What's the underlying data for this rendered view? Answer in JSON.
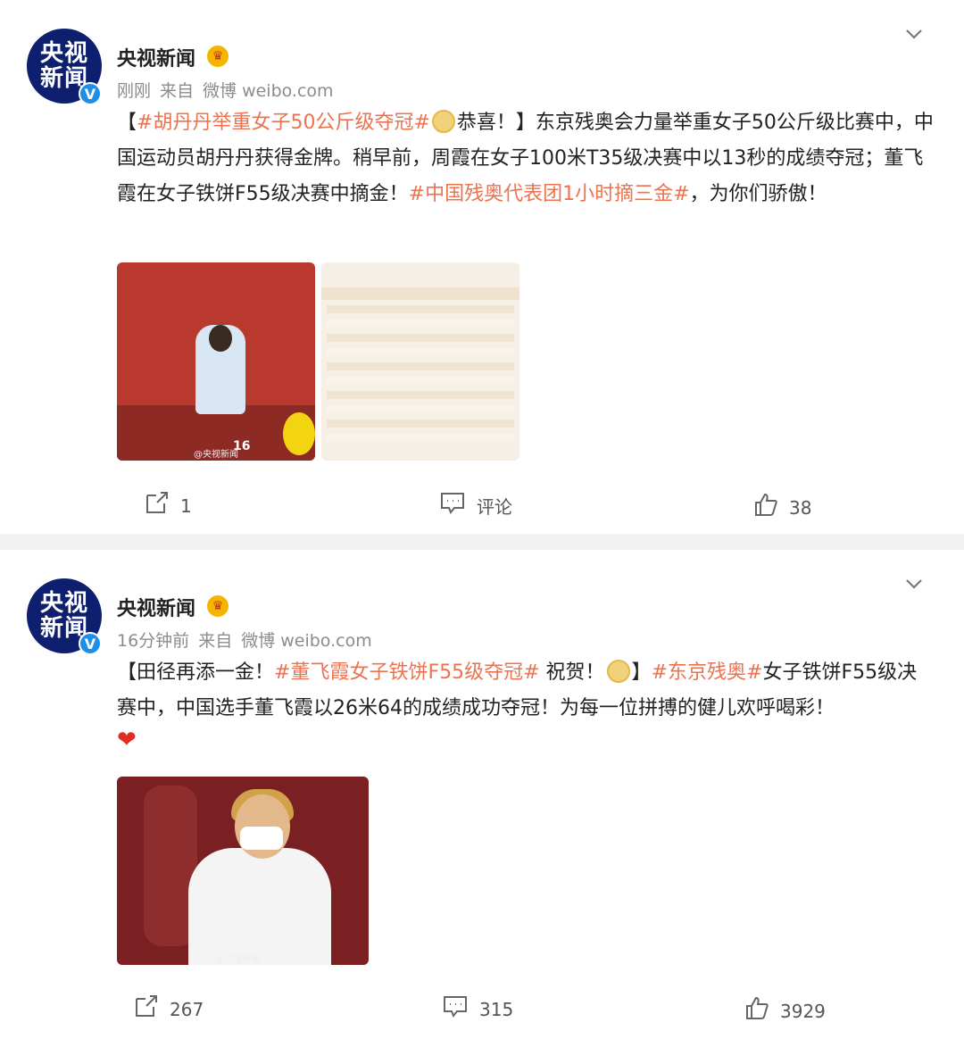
{
  "posts": [
    {
      "author": "央视新闻",
      "avatar_text_1": "央视",
      "avatar_text_2": "新闻",
      "verified_mark": "V",
      "time": "刚刚",
      "source_prefix": "来自",
      "source": "微博 weibo.com",
      "text": {
        "bracket_open": "【",
        "tag1": "#胡丹丹举重女子50公斤级夺冠#",
        "after_tag1": "恭喜！】东京残奥会力量举重女子50公斤级比赛中，中国运动员胡丹丹获得金牌。稍早前，周霞在女子100米T35级决赛中以13秒的成绩夺冠；董飞霞在女子铁饼F55级决赛中摘金！",
        "tag2": "#中国残奥代表团1小时摘三金#",
        "after_tag2": "，为你们骄傲！"
      },
      "images": [
        {
          "watermark": "@央视新闻",
          "number_text": "16"
        },
        {
          "type": "medal-table"
        }
      ],
      "repost_count": "1",
      "comment_label": "评论",
      "like_count": "38"
    },
    {
      "author": "央视新闻",
      "avatar_text_1": "央视",
      "avatar_text_2": "新闻",
      "verified_mark": "V",
      "time": "16分钟前",
      "source_prefix": "来自",
      "source": "微博 weibo.com",
      "text": {
        "part1": "【田径再添一金！",
        "tag1": "#董飞霞女子铁饼F55级夺冠#",
        "part2": " 祝贺！",
        "part3": "】",
        "tag2": "#东京残奥#",
        "part4": "女子铁饼F55级决赛中，中国选手董飞霞以26米64的成绩成功夺冠！为每一位拼搏的健儿欢呼喝彩！"
      },
      "images": [
        {
          "watermark": "@央视新闻"
        }
      ],
      "repost_count": "267",
      "comment_count": "315",
      "like_count": "3929"
    }
  ],
  "icons": {
    "crown": "crown-icon",
    "chevron": "chevron-down-icon",
    "repost": "repost-icon",
    "comment": "comment-icon",
    "like": "like-icon",
    "medal": "medal-emoji",
    "heart": "heart-emoji"
  },
  "colors": {
    "tag": "#eb7350",
    "avatar_bg": "#0d1f6e",
    "verified": "#1e8fe8",
    "divider": "#f2f2f2"
  }
}
